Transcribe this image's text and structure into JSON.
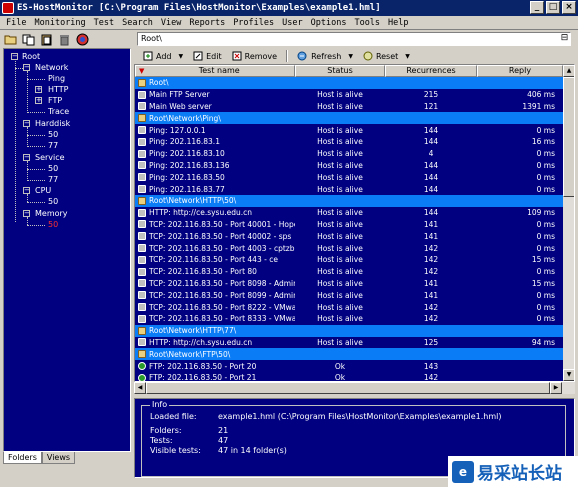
{
  "window": {
    "app_short": "ES-HostMonitor",
    "title": "[C:\\Program Files\\HostMonitor\\Examples\\example1.hml]",
    "btn_min": "_",
    "btn_max": "□",
    "btn_close": "×"
  },
  "menu": [
    "File",
    "Monitoring",
    "Test",
    "Search",
    "View",
    "Reports",
    "Profiles",
    "User",
    "Options",
    "Tools",
    "Help"
  ],
  "address": {
    "value": "Root\\"
  },
  "commands": {
    "add": "Add",
    "edit": "Edit",
    "remove": "Remove",
    "refresh": "Refresh",
    "reset": "Reset"
  },
  "tree": {
    "root": "Root",
    "network": "Network",
    "ping": "Ping",
    "http": "HTTP",
    "ftp": "FTP",
    "trace": "Trace",
    "harddisk": "Harddisk",
    "hd50": "50",
    "hd77": "77",
    "service": "Service",
    "sv50": "50",
    "sv77": "77",
    "cpu": "CPU",
    "cpu50": "50",
    "memory": "Memory",
    "mem50": "50"
  },
  "tabs": {
    "folders": "Folders",
    "views": "Views"
  },
  "columns": {
    "name": "Test name",
    "status": "Status",
    "recur": "Recurrences",
    "reply": "Reply"
  },
  "rows": [
    {
      "type": "grp",
      "name": "Root\\"
    },
    {
      "type": "host",
      "name": "Main FTP Server",
      "status": "Host is alive",
      "recur": "215",
      "reply": "406 ms"
    },
    {
      "type": "host",
      "name": "Main Web server",
      "status": "Host is alive",
      "recur": "121",
      "reply": "1391 ms"
    },
    {
      "type": "grp",
      "name": "Root\\Network\\Ping\\"
    },
    {
      "type": "host",
      "name": "Ping: 127.0.0.1",
      "status": "Host is alive",
      "recur": "144",
      "reply": "0 ms"
    },
    {
      "type": "host",
      "name": "Ping: 202.116.83.1",
      "status": "Host is alive",
      "recur": "144",
      "reply": "16 ms"
    },
    {
      "type": "host",
      "name": "Ping: 202.116.83.10",
      "status": "Host is alive",
      "recur": "4",
      "reply": "0 ms"
    },
    {
      "type": "host",
      "name": "Ping: 202.116.83.136",
      "status": "Host is alive",
      "recur": "144",
      "reply": "0 ms"
    },
    {
      "type": "host",
      "name": "Ping: 202.116.83.50",
      "status": "Host is alive",
      "recur": "144",
      "reply": "0 ms"
    },
    {
      "type": "host",
      "name": "Ping: 202.116.83.77",
      "status": "Host is alive",
      "recur": "144",
      "reply": "0 ms"
    },
    {
      "type": "grp",
      "name": "Root\\Network\\HTTP\\50\\"
    },
    {
      "type": "host",
      "name": "HTTP: http://ce.sysu.edu.cn",
      "status": "Host is alive",
      "recur": "144",
      "reply": "109 ms"
    },
    {
      "type": "host",
      "name": "TCP: 202.116.83.50 - Port 40001 - HopeStudio",
      "status": "Host is alive",
      "recur": "141",
      "reply": "0 ms"
    },
    {
      "type": "host",
      "name": "TCP: 202.116.83.50 - Port 40002 - sps",
      "status": "Host is alive",
      "recur": "141",
      "reply": "0 ms"
    },
    {
      "type": "host",
      "name": "TCP: 202.116.83.50 - Port 4003 - cptzb",
      "status": "Host is alive",
      "recur": "142",
      "reply": "0 ms"
    },
    {
      "type": "host",
      "name": "TCP: 202.116.83.50 - Port 443 - ce",
      "status": "Host is alive",
      "recur": "142",
      "reply": "15 ms"
    },
    {
      "type": "host",
      "name": "TCP: 202.116.83.50 - Port 80",
      "status": "Host is alive",
      "recur": "142",
      "reply": "0 ms"
    },
    {
      "type": "host",
      "name": "TCP: 202.116.83.50 - Port 8098 - Administration",
      "status": "Host is alive",
      "recur": "141",
      "reply": "15 ms"
    },
    {
      "type": "host",
      "name": "TCP: 202.116.83.50 - Port 8099 - Administration",
      "status": "Host is alive",
      "recur": "141",
      "reply": "0 ms"
    },
    {
      "type": "host",
      "name": "TCP: 202.116.83.50 - Port 8222 - VMware",
      "status": "Host is alive",
      "recur": "142",
      "reply": "0 ms"
    },
    {
      "type": "host",
      "name": "TCP: 202.116.83.50 - Port 8333 - VMware",
      "status": "Host is alive",
      "recur": "142",
      "reply": "0 ms"
    },
    {
      "type": "grp",
      "name": "Root\\Network\\HTTP\\77\\"
    },
    {
      "type": "host",
      "name": "HTTP: http://ch.sysu.edu.cn",
      "status": "Host is alive",
      "recur": "125",
      "reply": "94 ms"
    },
    {
      "type": "grp",
      "name": "Root\\Network\\FTP\\50\\"
    },
    {
      "type": "ok",
      "name": "FTP: 202.116.83.50 - Port 20",
      "status": "Ok",
      "recur": "143",
      "reply": ""
    },
    {
      "type": "ok",
      "name": "FTP: 202.116.83.50 - Port 21",
      "status": "Ok",
      "recur": "142",
      "reply": ""
    }
  ],
  "info": {
    "legend": "Info",
    "loaded_label": "Loaded file:",
    "loaded_value": "example1.hml  (C:\\Program Files\\HostMonitor\\Examples\\example1.hml)",
    "folders_label": "Folders:",
    "folders_value": "21",
    "tests_label": "Tests:",
    "tests_value": "47",
    "visible_label": "Visible tests:",
    "visible_value": "47 in 14 folder(s)"
  },
  "watermark": {
    "text": "易采站长站"
  },
  "colors": {
    "list_bg": "#000080",
    "group_row": "#0a7cf5",
    "title_bar": "#0a246a",
    "alert_red": "#ff3030"
  }
}
